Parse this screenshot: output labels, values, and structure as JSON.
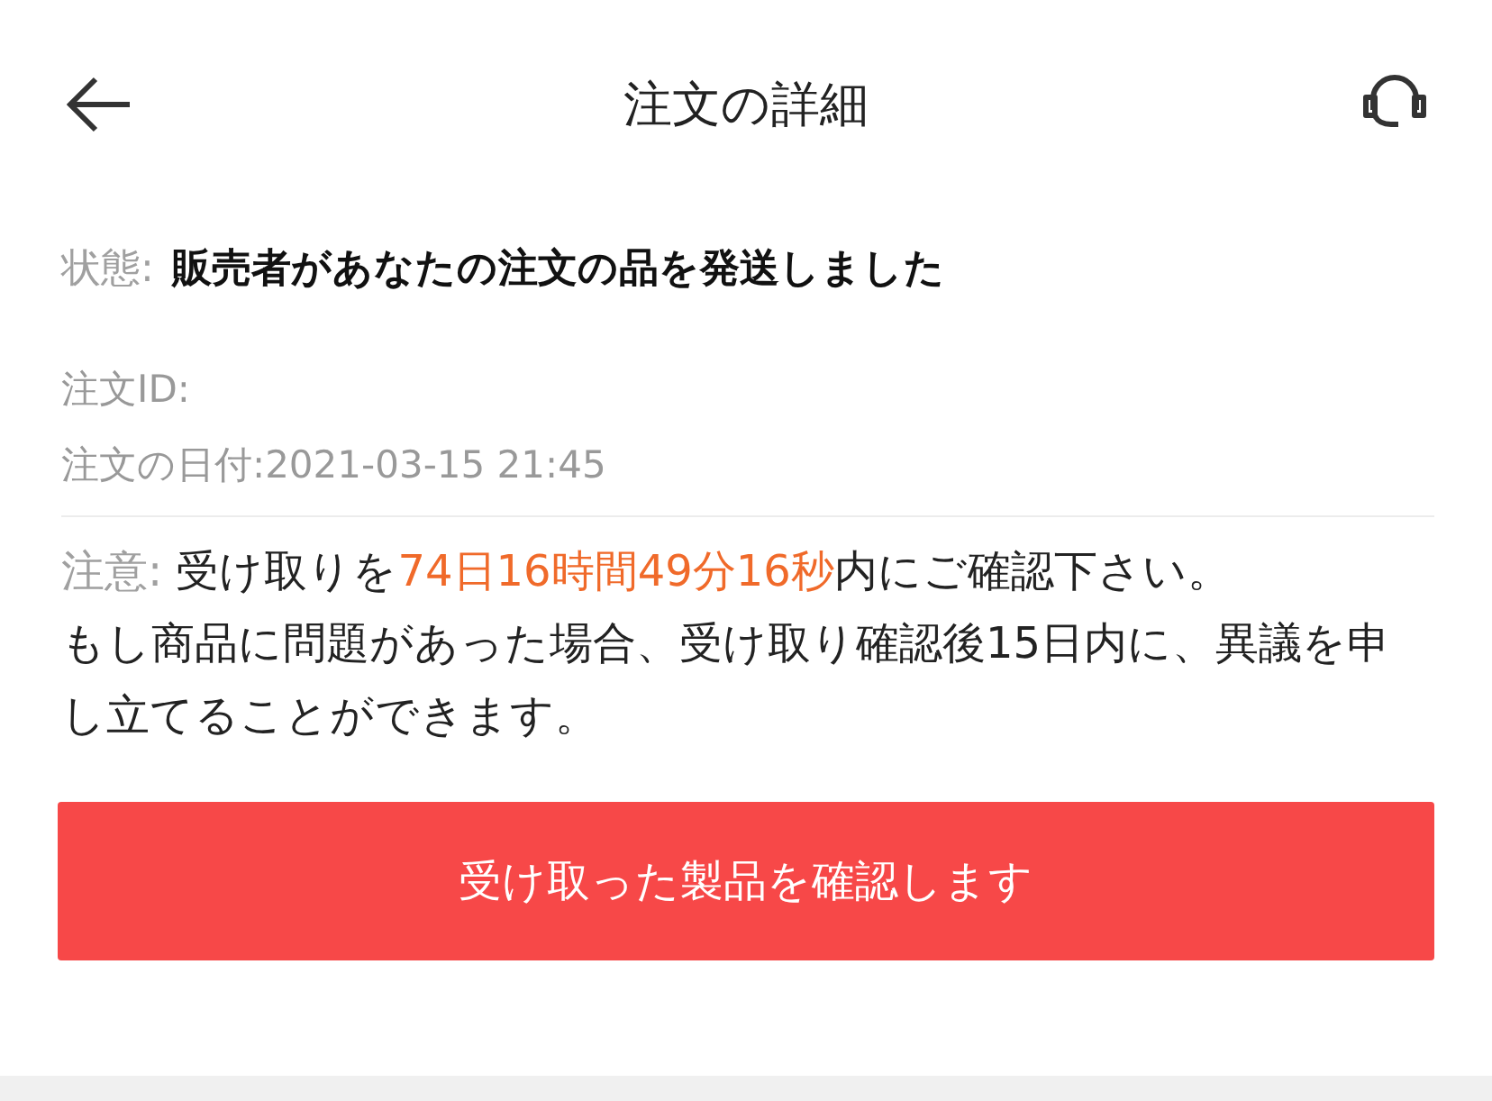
{
  "header": {
    "title": "注文の詳細"
  },
  "status": {
    "label": "状態:",
    "value": "販売者があなたの注文の品を発送しました"
  },
  "order_id": {
    "label": "注文ID:"
  },
  "order_date": "注文の日付:2021-03-15 21:45",
  "notice": {
    "label": "注意:",
    "before": "受け取りを",
    "countdown": "74日16時間49分16秒",
    "after": "内にご確認下さい。",
    "details": "もし商品に問題があった場合、受け取り確認後15日内に、異議を申し立てることができます。"
  },
  "confirm_button": "受け取った製品を確認します"
}
